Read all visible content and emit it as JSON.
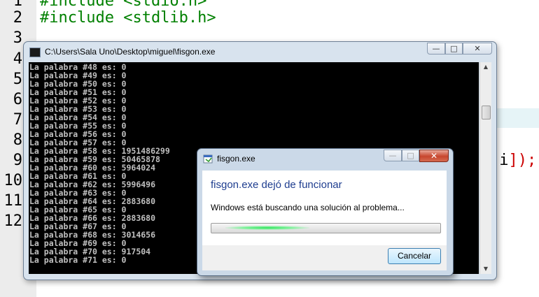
{
  "editor": {
    "line_numbers": [
      "1",
      "2",
      "3",
      "4",
      "5",
      "6",
      "7",
      "8",
      "9",
      "10",
      "11",
      "12"
    ],
    "code_line_1": "#include <stdio.h>",
    "code_line_2": "#include <stdlib.h>",
    "code_line_9_text": "i",
    "code_line_9_open": "[",
    "code_line_9_close": "]);"
  },
  "console": {
    "title": "C:\\Users\\Sala Uno\\Desktop\\miguel\\fisgon.exe",
    "minimize_glyph": "—",
    "maximize_glyph": "□",
    "close_glyph": "✕",
    "lines": [
      "La palabra #48 es: 0",
      "La palabra #49 es: 0",
      "La palabra #50 es: 0",
      "La palabra #51 es: 0",
      "La palabra #52 es: 0",
      "La palabra #53 es: 0",
      "La palabra #54 es: 0",
      "La palabra #55 es: 0",
      "La palabra #56 es: 0",
      "La palabra #57 es: 0",
      "La palabra #58 es: 1951486299",
      "La palabra #59 es: 50465878",
      "La palabra #60 es: 5964024",
      "La palabra #61 es: 0",
      "La palabra #62 es: 5996496",
      "La palabra #63 es: 0",
      "La palabra #64 es: 2883680",
      "La palabra #65 es: 0",
      "La palabra #66 es: 2883680",
      "La palabra #67 es: 0",
      "La palabra #68 es: 3014656",
      "La palabra #69 es: 0",
      "La palabra #70 es: 917504",
      "La palabra #71 es: 0"
    ],
    "scroll_up": "▲",
    "scroll_down": "▼"
  },
  "dialog": {
    "title": "fisgon.exe",
    "heading": "fisgon.exe dejó de funcionar",
    "message": "Windows está buscando una solución al problema...",
    "cancel_label": "Cancelar",
    "close_glyph": "✕",
    "progress_state": "indeterminate"
  }
}
